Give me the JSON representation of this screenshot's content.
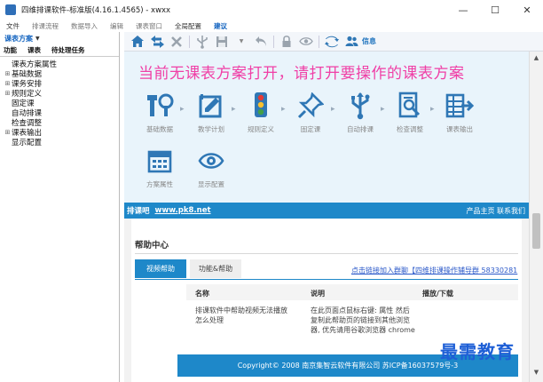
{
  "window": {
    "title": "四维排课软件-标准版(4.16.1.4565) - xwxx",
    "controls": [
      "—",
      "☐",
      "✕"
    ]
  },
  "menu": [
    {
      "label": "文件",
      "style": ""
    },
    {
      "label": "排课流程",
      "style": "dim"
    },
    {
      "label": "数据导入",
      "style": "dim"
    },
    {
      "label": "编辑",
      "style": "dim"
    },
    {
      "label": "课表窗口",
      "style": "dim"
    },
    {
      "label": "全局配置",
      "style": ""
    },
    {
      "label": "建议",
      "style": "active"
    }
  ],
  "left": {
    "scheme_dropdown": "课表方案",
    "tabs": [
      "功能",
      "课表",
      "待处理任务"
    ],
    "tree": [
      {
        "label": "课表方案属性",
        "expand": ""
      },
      {
        "label": "基础数据",
        "expand": "⊞"
      },
      {
        "label": "课务安排",
        "expand": "⊞"
      },
      {
        "label": "规则定义",
        "expand": "⊞"
      },
      {
        "label": "固定课",
        "expand": ""
      },
      {
        "label": "自动排课",
        "expand": ""
      },
      {
        "label": "检查调整",
        "expand": ""
      },
      {
        "label": "课表输出",
        "expand": "⊞"
      },
      {
        "label": "显示配置",
        "expand": ""
      }
    ]
  },
  "toolbar": {
    "info_label": "信息"
  },
  "main": {
    "headline": "当前无课表方案打开，请打开要操作的课表方案",
    "workflow": [
      {
        "label": "基础数据",
        "icon": "tools-icon"
      },
      {
        "label": "教学计划",
        "icon": "plan-icon"
      },
      {
        "label": "规则定义",
        "icon": "traffic-light-icon"
      },
      {
        "label": "固定课",
        "icon": "pin-icon"
      },
      {
        "label": "自动排课",
        "icon": "usb-icon"
      },
      {
        "label": "检查调整",
        "icon": "inspect-icon"
      },
      {
        "label": "课表输出",
        "icon": "export-icon"
      }
    ],
    "extras": [
      {
        "label": "方案属性",
        "icon": "calendar-icon"
      },
      {
        "label": "显示配置",
        "icon": "eye-icon"
      }
    ]
  },
  "banner": {
    "site_prefix": "排课吧",
    "site_url": "www.pk8.net",
    "links": "产品主页  联系我们"
  },
  "help": {
    "title": "帮助中心",
    "tab_video": "视频帮助",
    "tab_func": "功能&帮助",
    "qq_link": "点击链接加入群聊【四维排课操作辅导群 58330281",
    "columns": [
      "名称",
      "说明",
      "播放/下载"
    ],
    "rows": [
      {
        "name": "排课软件中帮助视频无法播放怎么处理",
        "desc": "在此页面点鼠标右键: 属性 然后复制此帮助页的链接到其他浏览器, 优先请用谷歌浏览器 chrome"
      }
    ],
    "footer": "Copyright© 2008 南京集智云软件有限公司 苏ICP备16037579号-3"
  },
  "watermark": "最需教育",
  "colors": {
    "accent": "#1e88c9",
    "headline": "#f03fa6",
    "content_bg": "#e9f4fb",
    "icon": "#2f77b5"
  }
}
